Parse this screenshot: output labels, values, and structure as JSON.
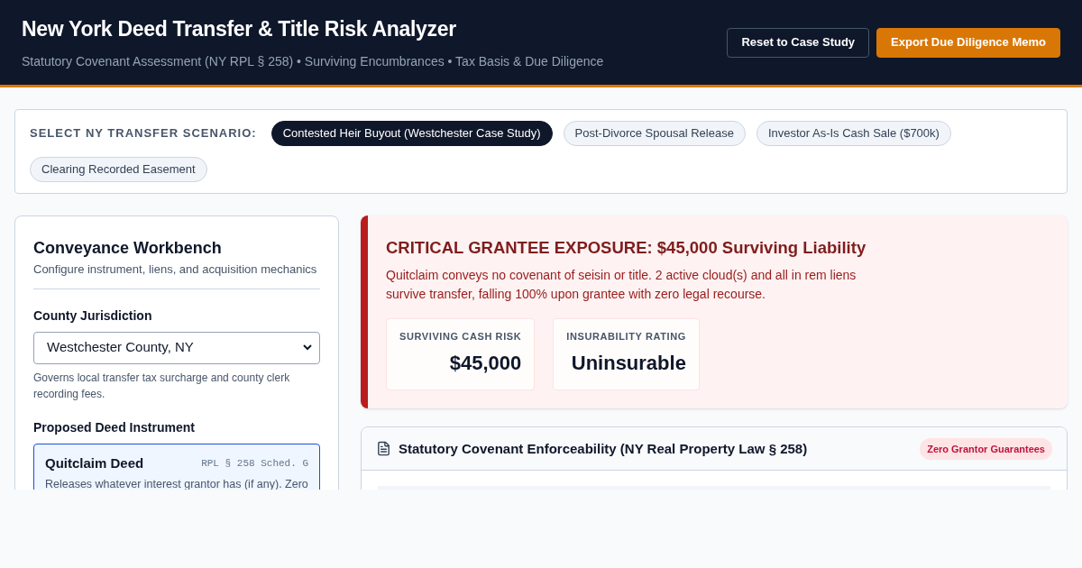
{
  "header": {
    "title": "New York Deed Transfer & Title Risk Analyzer",
    "subtitle": "Statutory Covenant Assessment (NY RPL § 258) • Surviving Encumbrances • Tax Basis & Due Diligence",
    "buttons": [
      {
        "label": "Reset to Case Study",
        "kind": "secondary"
      },
      {
        "label": "Export Due Diligence Memo",
        "kind": "primary"
      }
    ]
  },
  "scenarios": {
    "label": "SELECT NY TRANSFER SCENARIO:",
    "items": [
      {
        "label": "Contested Heir Buyout (Westchester Case Study)",
        "selected": true
      },
      {
        "label": "Post-Divorce Spousal Release",
        "selected": false
      },
      {
        "label": "Investor As-Is Cash Sale ($700k)",
        "selected": false
      },
      {
        "label": "Clearing Recorded Easement",
        "selected": false
      }
    ]
  },
  "workbench": {
    "title": "Conveyance Workbench",
    "subtitle": "Configure instrument, liens, and acquisition mechanics",
    "county": {
      "label": "County Jurisdiction",
      "value": "Westchester County, NY",
      "help": "Governs local transfer tax surcharge and county clerk recording fees."
    },
    "instrument": {
      "label": "Proposed Deed Instrument",
      "options": [
        {
          "name": "Quitclaim Deed",
          "code": "RPL § 258 Sched. G",
          "description": "Releases whatever interest grantor has (if any). Zero",
          "selected": true
        }
      ]
    }
  },
  "alert": {
    "title": "CRITICAL GRANTEE EXPOSURE: $45,000 Surviving Liability",
    "body": "Quitclaim conveys no covenant of seisin or title. 2 active cloud(s) and all in rem liens survive transfer, falling 100% upon grantee with zero legal recourse.",
    "metrics": [
      {
        "label": "SURVIVING CASH RISK",
        "value": "$45,000"
      },
      {
        "label": "INSURABILITY RATING",
        "value": "Uninsurable"
      }
    ]
  },
  "covenants": {
    "title": "Statutory Covenant Enforceability (NY Real Property Law § 258)",
    "badge": "Zero Grantor Guarantees"
  }
}
